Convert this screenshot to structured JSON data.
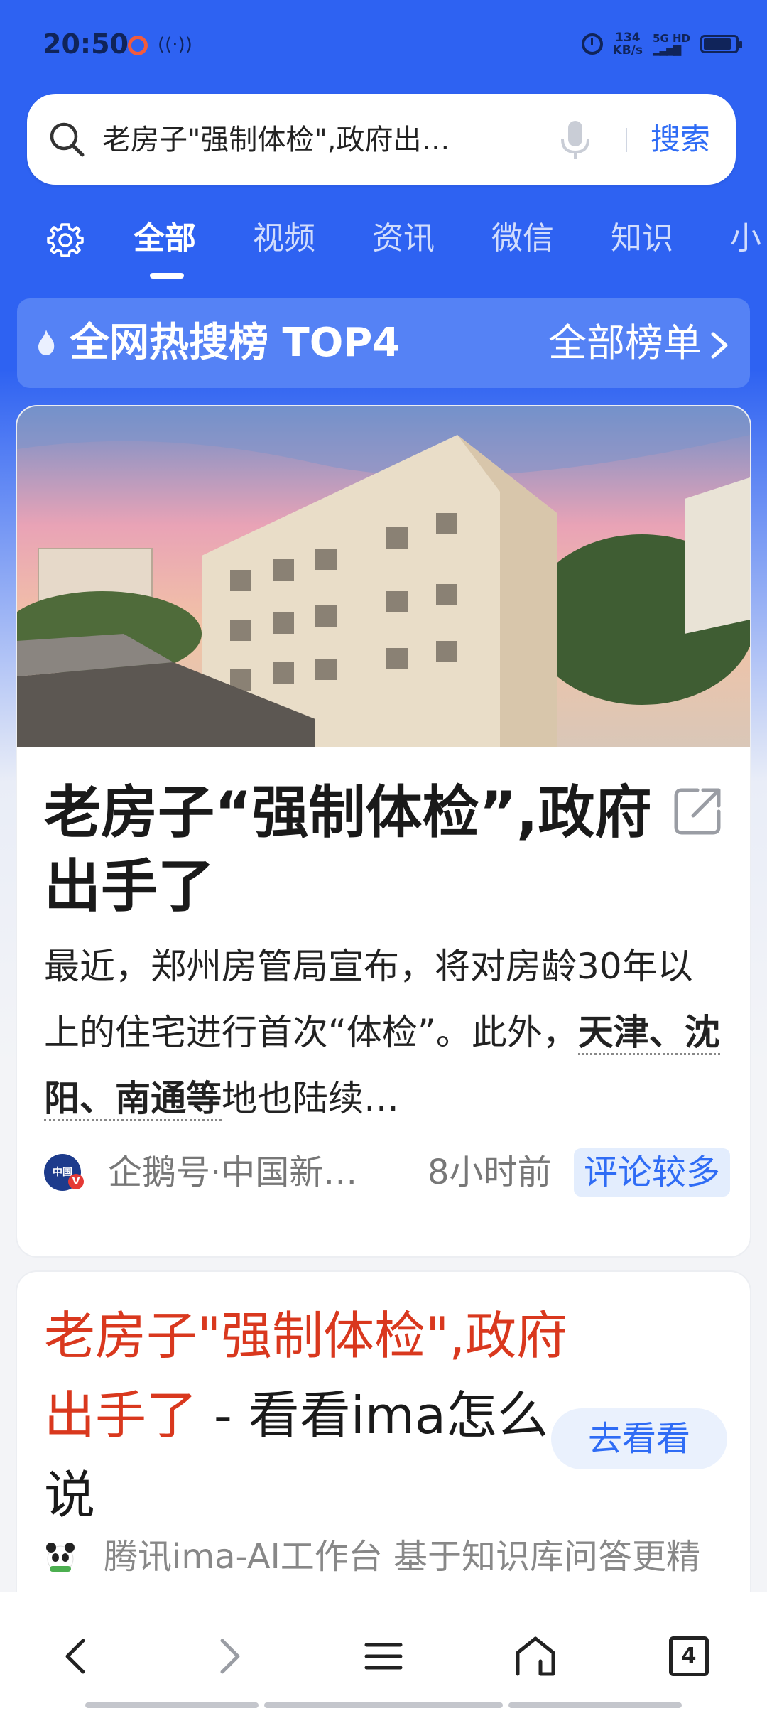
{
  "status_bar": {
    "time": "20:50",
    "net_speed_value": "134",
    "net_speed_unit": "KB/s",
    "network": "5G HD"
  },
  "search": {
    "query": "老房子\"强制体检\",政府出…",
    "button_label": "搜索"
  },
  "tabs": [
    {
      "label": "全部",
      "active": true
    },
    {
      "label": "视频"
    },
    {
      "label": "资讯"
    },
    {
      "label": "微信"
    },
    {
      "label": "知识"
    },
    {
      "label": "小"
    }
  ],
  "hot_rank": {
    "title": "全网热搜榜 TOP4",
    "all_label": "全部榜单"
  },
  "news_card": {
    "title": "老房子“强制体检”,政府出手了",
    "summary_pre": "最近，郑州房管局宣布，将对房龄30年以上的住宅进行首次“体检”。此外，",
    "summary_highlight": "天津、沈阳、南通等",
    "summary_post": "地也陆续…",
    "source": "企鹅号·中国新…",
    "time": "8小时前",
    "tag": "评论较多",
    "avatar_text": "中国"
  },
  "ima_card": {
    "title_red": "老房子\"强制体检\",政府出手了",
    "title_rest": " - 看看ima怎么说",
    "button_label": "去看看",
    "source": "腾讯ima-AI工作台 基于知识库问答更精"
  },
  "bottom_nav": {
    "tab_count": "4"
  },
  "colors": {
    "brand_blue": "#2e62f2",
    "accent_blue": "#2f6cf5",
    "headline_red": "#d9381e"
  }
}
